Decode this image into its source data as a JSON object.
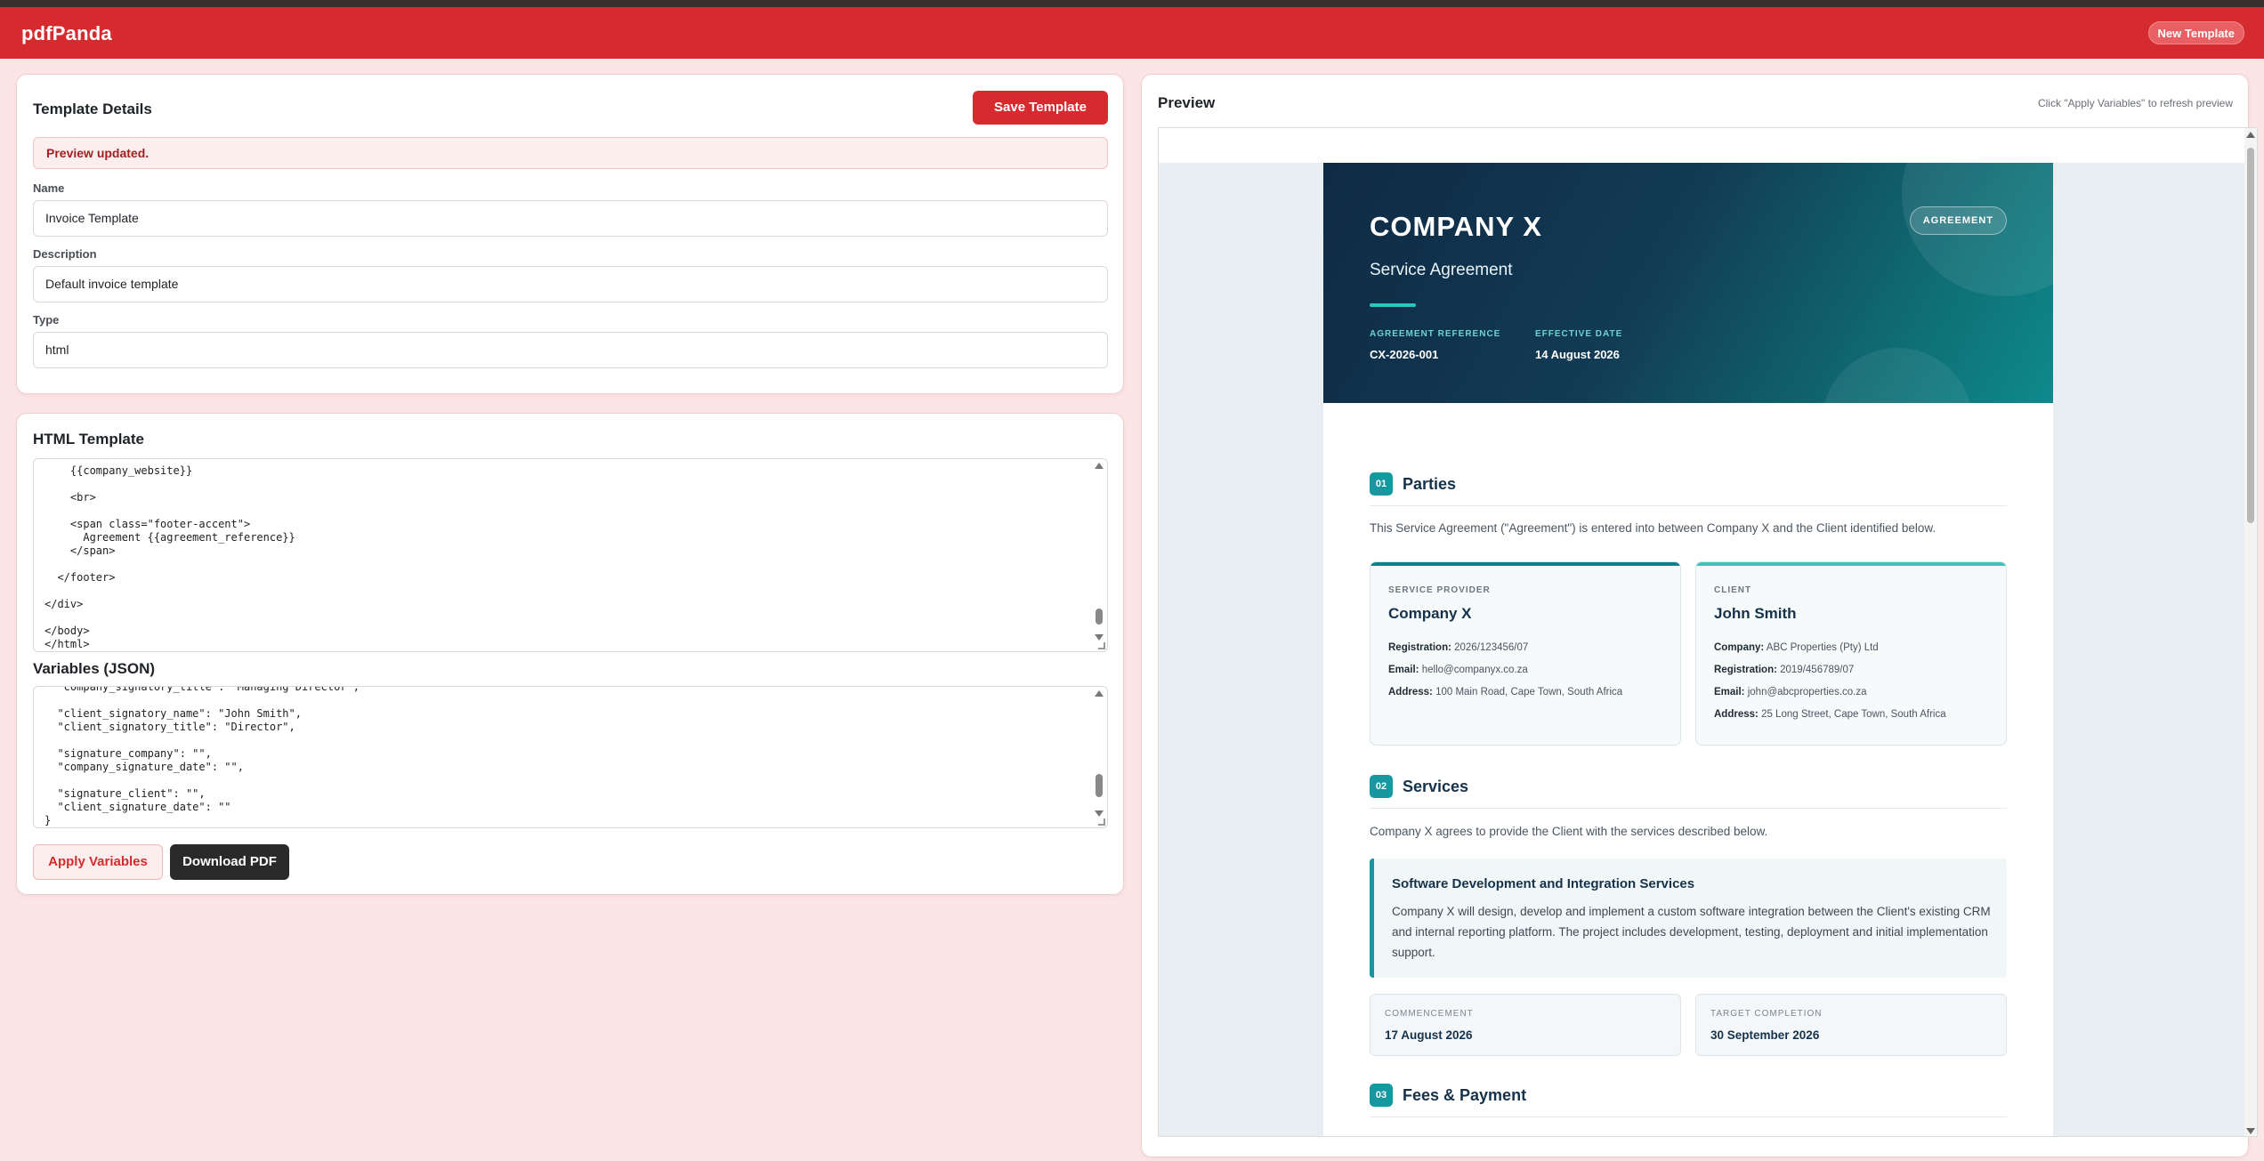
{
  "app": {
    "brand": "pdfPanda",
    "new_template_label": "New Template"
  },
  "template_details": {
    "title": "Template Details",
    "save_label": "Save Template",
    "alert": "Preview updated.",
    "name_label": "Name",
    "name_value": "Invoice Template",
    "description_label": "Description",
    "description_value": "Default invoice template",
    "type_label": "Type",
    "type_value": "html"
  },
  "html_template": {
    "title": "HTML Template",
    "code": "    {{company_website}}\n\n    <br>\n\n    <span class=\"footer-accent\">\n      Agreement {{agreement_reference}}\n    </span>\n\n  </footer>\n\n</div>\n\n</body>\n</html>"
  },
  "variables": {
    "title": "Variables (JSON)",
    "code": "  \"company_signatory_title\": \"Managing Director\",\n\n  \"client_signatory_name\": \"John Smith\",\n  \"client_signatory_title\": \"Director\",\n\n  \"signature_company\": \"\",\n  \"company_signature_date\": \"\",\n\n  \"signature_client\": \"\",\n  \"client_signature_date\": \"\"\n}",
    "apply_label": "Apply Variables",
    "download_label": "Download PDF"
  },
  "preview": {
    "title": "Preview",
    "hint": "Click \"Apply Variables\" to refresh preview",
    "doc": {
      "company": "COMPANY X",
      "subtitle": "Service Agreement",
      "badge": "AGREEMENT",
      "ref_label": "AGREEMENT REFERENCE",
      "ref_value": "CX-2026-001",
      "date_label": "EFFECTIVE DATE",
      "date_value": "14 August 2026",
      "sections": [
        {
          "num": "01",
          "title": "Parties"
        },
        {
          "num": "02",
          "title": "Services"
        },
        {
          "num": "03",
          "title": "Fees & Payment"
        }
      ],
      "parties_intro": "This Service Agreement (\"Agreement\") is entered into between Company X and the Client identified below.",
      "provider": {
        "label": "SERVICE PROVIDER",
        "name": "Company X",
        "rows": [
          {
            "k": "Registration:",
            "v": "2026/123456/07"
          },
          {
            "k": "Email:",
            "v": "hello@companyx.co.za"
          },
          {
            "k": "Address:",
            "v": "100 Main Road, Cape Town, South Africa"
          }
        ]
      },
      "client": {
        "label": "CLIENT",
        "name": "John Smith",
        "rows": [
          {
            "k": "Company:",
            "v": "ABC Properties (Pty) Ltd"
          },
          {
            "k": "Registration:",
            "v": "2019/456789/07"
          },
          {
            "k": "Email:",
            "v": "john@abcproperties.co.za"
          },
          {
            "k": "Address:",
            "v": "25 Long Street, Cape Town, South Africa"
          }
        ]
      },
      "services_intro": "Company X agrees to provide the Client with the services described below.",
      "service_title": "Software Development and Integration Services",
      "service_desc": "Company X will design, develop and implement a custom software integration between the Client's existing CRM and internal reporting platform. The project includes development, testing, deployment and initial implementation support.",
      "commencement_label": "COMMENCEMENT",
      "commencement_value": "17 August 2026",
      "completion_label": "TARGET COMPLETION",
      "completion_value": "30 September 2026"
    }
  }
}
